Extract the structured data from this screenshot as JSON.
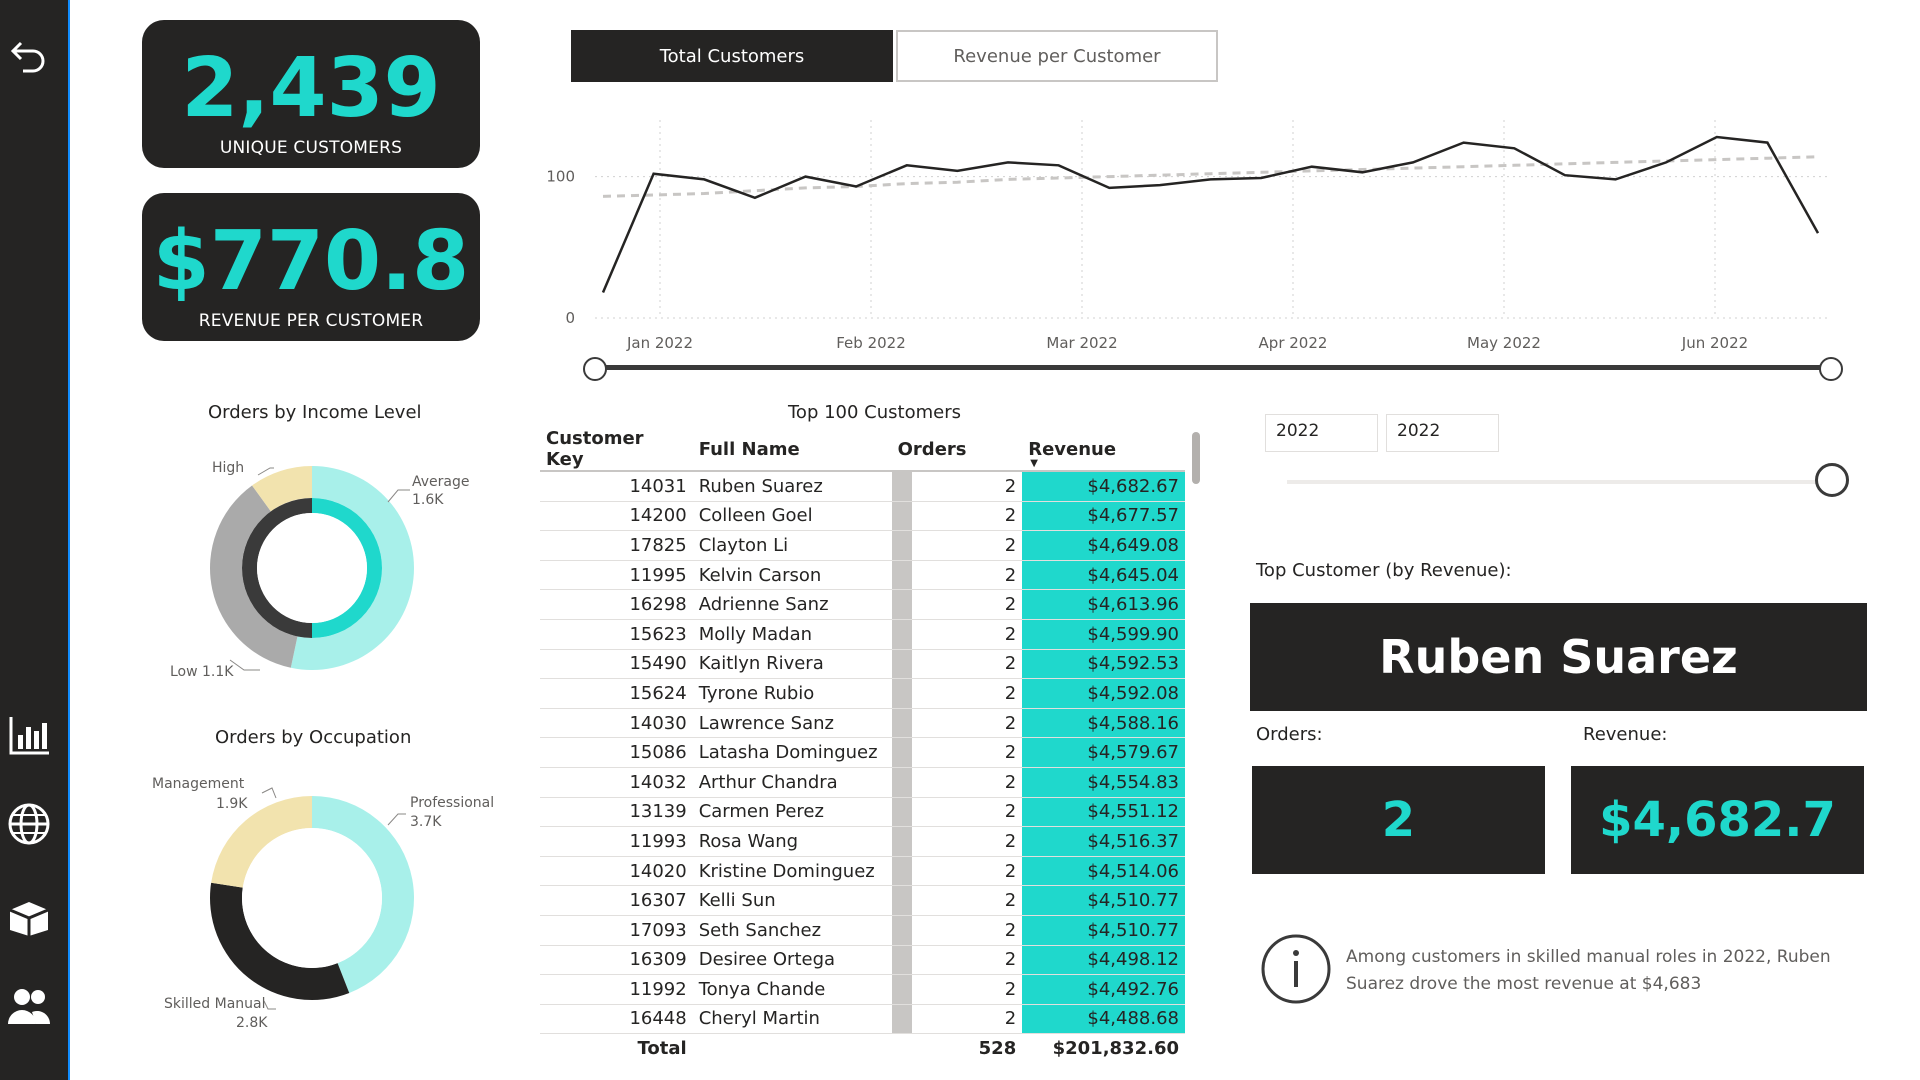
{
  "sidebar": {
    "icons": [
      "back-arrow-icon",
      "bar-chart-icon",
      "globe-icon",
      "box-icon",
      "users-icon"
    ]
  },
  "kpis": {
    "unique_customers": {
      "value": "2,439",
      "label": "UNIQUE CUSTOMERS"
    },
    "revenue_per_customer": {
      "value": "$770.8",
      "label": "REVENUE PER CUSTOMER"
    }
  },
  "tabs": {
    "active": "Total Customers",
    "inactive": "Revenue per Customer"
  },
  "line_chart": {
    "chart_data": {
      "type": "line",
      "x": [
        "Jan 2022",
        "Feb 2022",
        "Mar 2022",
        "Apr 2022",
        "May 2022",
        "Jun 2022"
      ],
      "y_ticks": [
        "0",
        "100"
      ],
      "ylim": [
        0,
        140
      ],
      "series": [
        {
          "values": [
            18,
            102,
            98,
            85,
            100,
            93,
            108,
            104,
            110,
            108,
            92,
            94,
            98,
            99,
            107,
            103,
            110,
            124,
            120,
            101,
            98,
            110,
            128,
            124,
            60
          ]
        },
        {
          "values": [
            86,
            87,
            88,
            90,
            92,
            93,
            95,
            96,
            98,
            99,
            100,
            101,
            102,
            103,
            104,
            105,
            106,
            107,
            108,
            109,
            110,
            111,
            112,
            113,
            114
          ]
        }
      ],
      "grid": true
    }
  },
  "table": {
    "title": "Top 100 Customers",
    "columns": [
      "Customer Key",
      "Full Name",
      "Orders",
      "Revenue"
    ],
    "rows": [
      [
        "14031",
        "Ruben Suarez",
        "2",
        "$4,682.67"
      ],
      [
        "14200",
        "Colleen Goel",
        "2",
        "$4,677.57"
      ],
      [
        "17825",
        "Clayton Li",
        "2",
        "$4,649.08"
      ],
      [
        "11995",
        "Kelvin Carson",
        "2",
        "$4,645.04"
      ],
      [
        "16298",
        "Adrienne Sanz",
        "2",
        "$4,613.96"
      ],
      [
        "15623",
        "Molly Madan",
        "2",
        "$4,599.90"
      ],
      [
        "15490",
        "Kaitlyn Rivera",
        "2",
        "$4,592.53"
      ],
      [
        "15624",
        "Tyrone Rubio",
        "2",
        "$4,592.08"
      ],
      [
        "14030",
        "Lawrence Sanz",
        "2",
        "$4,588.16"
      ],
      [
        "15086",
        "Latasha Dominguez",
        "2",
        "$4,579.67"
      ],
      [
        "14032",
        "Arthur Chandra",
        "2",
        "$4,554.83"
      ],
      [
        "13139",
        "Carmen Perez",
        "2",
        "$4,551.12"
      ],
      [
        "11993",
        "Rosa Wang",
        "2",
        "$4,516.37"
      ],
      [
        "14020",
        "Kristine Dominguez",
        "2",
        "$4,514.06"
      ],
      [
        "16307",
        "Kelli Sun",
        "2",
        "$4,510.77"
      ],
      [
        "17093",
        "Seth Sanchez",
        "2",
        "$4,510.77"
      ],
      [
        "16309",
        "Desiree Ortega",
        "2",
        "$4,498.12"
      ],
      [
        "11992",
        "Tonya Chande",
        "2",
        "$4,492.76"
      ],
      [
        "16448",
        "Cheryl Martin",
        "2",
        "$4,488.68"
      ]
    ],
    "total": {
      "label": "Total",
      "orders": "528",
      "revenue": "$201,832.60"
    }
  },
  "income_chart": {
    "chart_data": {
      "type": "pie",
      "title": "Orders by Income Level",
      "labels": [
        "Average",
        "Low",
        "High"
      ],
      "values": [
        1.6,
        1.1,
        0.3
      ],
      "value_labels": [
        "1.6K",
        "1.1K",
        ""
      ],
      "colors": [
        "#a8f0ea",
        "#aaaaaa",
        "#f2e3ae"
      ]
    },
    "label_avg": "Average",
    "value_avg": "1.6K",
    "label_high": "High",
    "label_low": "Low 1.1K"
  },
  "occupation_chart": {
    "chart_data": {
      "type": "pie",
      "title": "Orders by Occupation",
      "labels": [
        "Professional",
        "Skilled Manual",
        "Management"
      ],
      "values": [
        3.7,
        2.8,
        1.9
      ],
      "value_labels": [
        "3.7K",
        "2.8K",
        "1.9K"
      ],
      "colors": [
        "#a8f0ea",
        "#252423",
        "#f2e3ae"
      ]
    }
  },
  "filters": {
    "year_from": "2022",
    "year_to": "2022"
  },
  "top_customer": {
    "heading": "Top Customer (by Revenue):",
    "name": "Ruben Suarez",
    "orders_label": "Orders:",
    "revenue_label": "Revenue:",
    "orders_value": "2",
    "revenue_value": "$4,682.7"
  },
  "insight": {
    "icon": "info-icon",
    "text": "Among customers in skilled manual roles in 2022, Ruben Suarez drove the most revenue at $4,683"
  },
  "colors": {
    "teal": "#1fd8cc",
    "dark": "#252423",
    "light_teal": "#a8f0ea",
    "beige": "#f2e3ae",
    "grey": "#aaaaaa",
    "accent_border": "#118DFF"
  }
}
